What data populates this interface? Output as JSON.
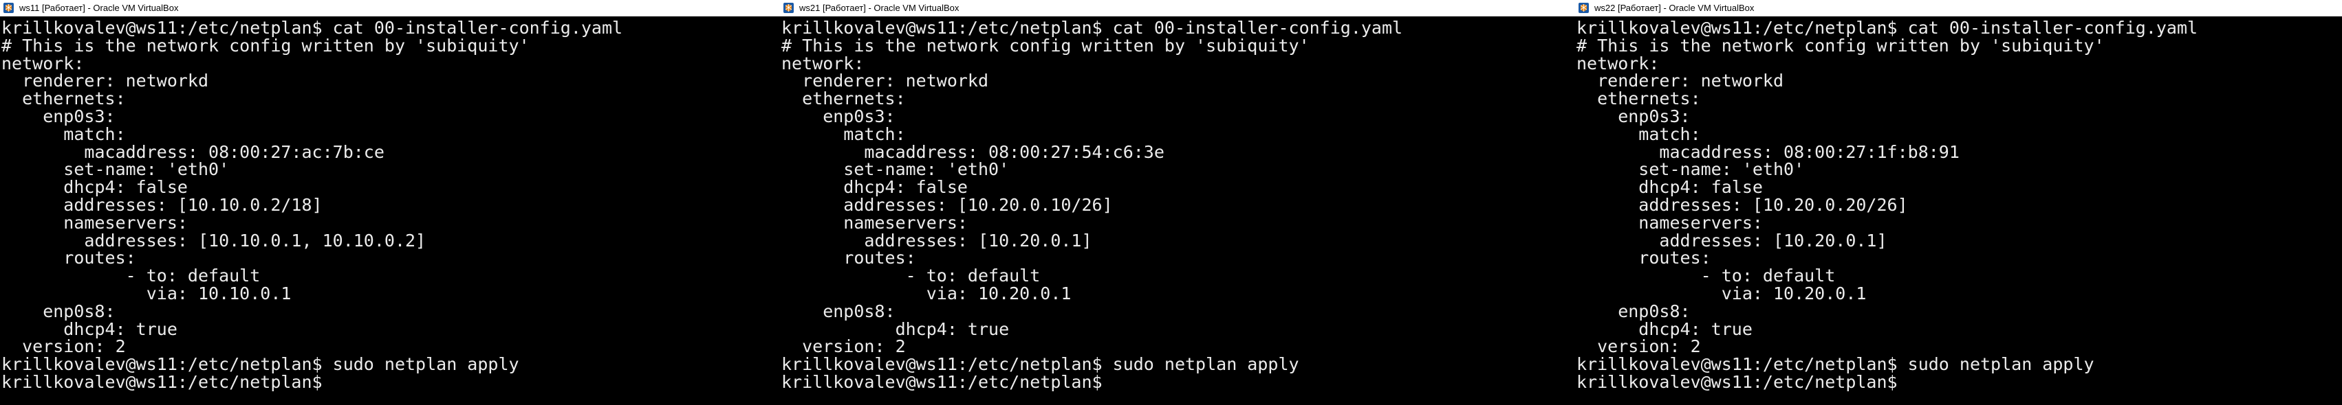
{
  "windows": [
    {
      "title": "ws11 [Работает] - Oracle VM VirtualBox",
      "lines": [
        "krillkovalev@ws11:/etc/netplan$ cat 00-installer-config.yaml",
        "# This is the network config written by 'subiquity'",
        "network:",
        "  renderer: networkd",
        "  ethernets:",
        "    enp0s3:",
        "      match:",
        "        macaddress: 08:00:27:ac:7b:ce",
        "      set-name: 'eth0'",
        "      dhcp4: false",
        "      addresses: [10.10.0.2/18]",
        "      nameservers:",
        "        addresses: [10.10.0.1, 10.10.0.2]",
        "      routes:",
        "            - to: default",
        "              via: 10.10.0.1",
        "    enp0s8:",
        "      dhcp4: true",
        "  version: 2",
        "krillkovalev@ws11:/etc/netplan$ sudo netplan apply",
        "krillkovalev@ws11:/etc/netplan$"
      ]
    },
    {
      "title": "ws21 [Работает] - Oracle VM VirtualBox",
      "lines": [
        "krillkovalev@ws11:/etc/netplan$ cat 00-installer-config.yaml",
        "# This is the network config written by 'subiquity'",
        "network:",
        "  renderer: networkd",
        "  ethernets:",
        "    enp0s3:",
        "      match:",
        "        macaddress: 08:00:27:54:c6:3e",
        "      set-name: 'eth0'",
        "      dhcp4: false",
        "      addresses: [10.20.0.10/26]",
        "      nameservers:",
        "        addresses: [10.20.0.1]",
        "      routes:",
        "            - to: default",
        "              via: 10.20.0.1",
        "    enp0s8:",
        "           dhcp4: true",
        "  version: 2",
        "krillkovalev@ws11:/etc/netplan$ sudo netplan apply",
        "krillkovalev@ws11:/etc/netplan$"
      ]
    },
    {
      "title": "ws22 [Работает] - Oracle VM VirtualBox",
      "lines": [
        "krillkovalev@ws11:/etc/netplan$ cat 00-installer-config.yaml",
        "# This is the network config written by 'subiquity'",
        "network:",
        "  renderer: networkd",
        "  ethernets:",
        "    enp0s3:",
        "      match:",
        "        macaddress: 08:00:27:1f:b8:91",
        "      set-name: 'eth0'",
        "      dhcp4: false",
        "      addresses: [10.20.0.20/26]",
        "      nameservers:",
        "        addresses: [10.20.0.1]",
        "      routes:",
        "            - to: default",
        "              via: 10.20.0.1",
        "    enp0s8:",
        "      dhcp4: true",
        "  version: 2",
        "krillkovalev@ws11:/etc/netplan$ sudo netplan apply",
        "krillkovalev@ws11:/etc/netplan$"
      ]
    }
  ],
  "colors": {
    "terminal_bg": "#000000",
    "terminal_fg": "#ececec",
    "titlebar_bg": "#ffffff",
    "titlebar_fg": "#000000",
    "icon_blue": "#1c5aa6",
    "icon_orange": "#e8891c"
  },
  "icons": {
    "app_icon": "virtualbox-icon"
  }
}
